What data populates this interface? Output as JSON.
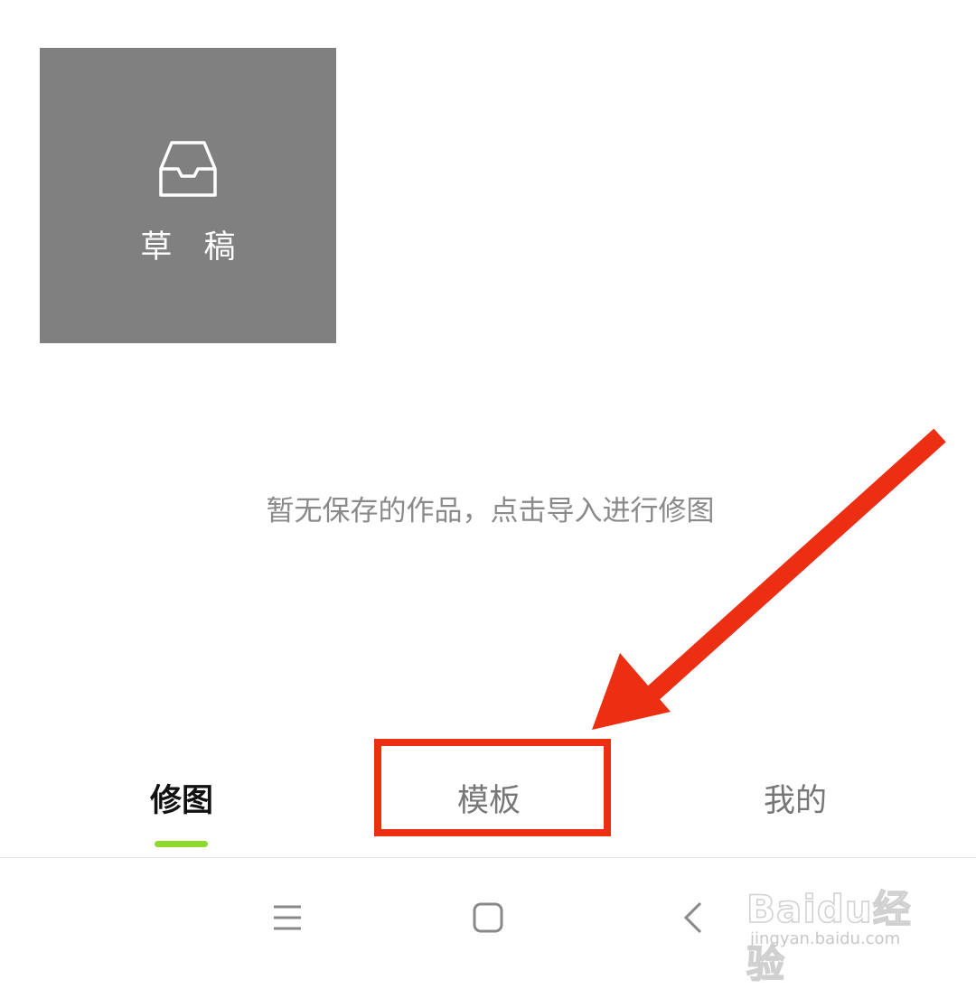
{
  "drafts": {
    "label": "草 稿",
    "icon": "inbox-tray-icon"
  },
  "empty_state": {
    "message": "暂无保存的作品，点击导入进行修图"
  },
  "tabs": [
    {
      "label": "修图",
      "active": true
    },
    {
      "label": "模板",
      "active": false
    },
    {
      "label": "我的",
      "active": false
    }
  ],
  "colors": {
    "accent": "#8fd92d",
    "annotation": "#ec2e12",
    "card": "#808080"
  },
  "annotation": {
    "type": "arrow-and-box",
    "target": "模板"
  },
  "system_nav": {
    "icons": [
      "menu-icon",
      "home-icon",
      "back-icon"
    ]
  },
  "watermark": {
    "logo": "Baidu经验",
    "url": "jingyan.baidu.com"
  }
}
